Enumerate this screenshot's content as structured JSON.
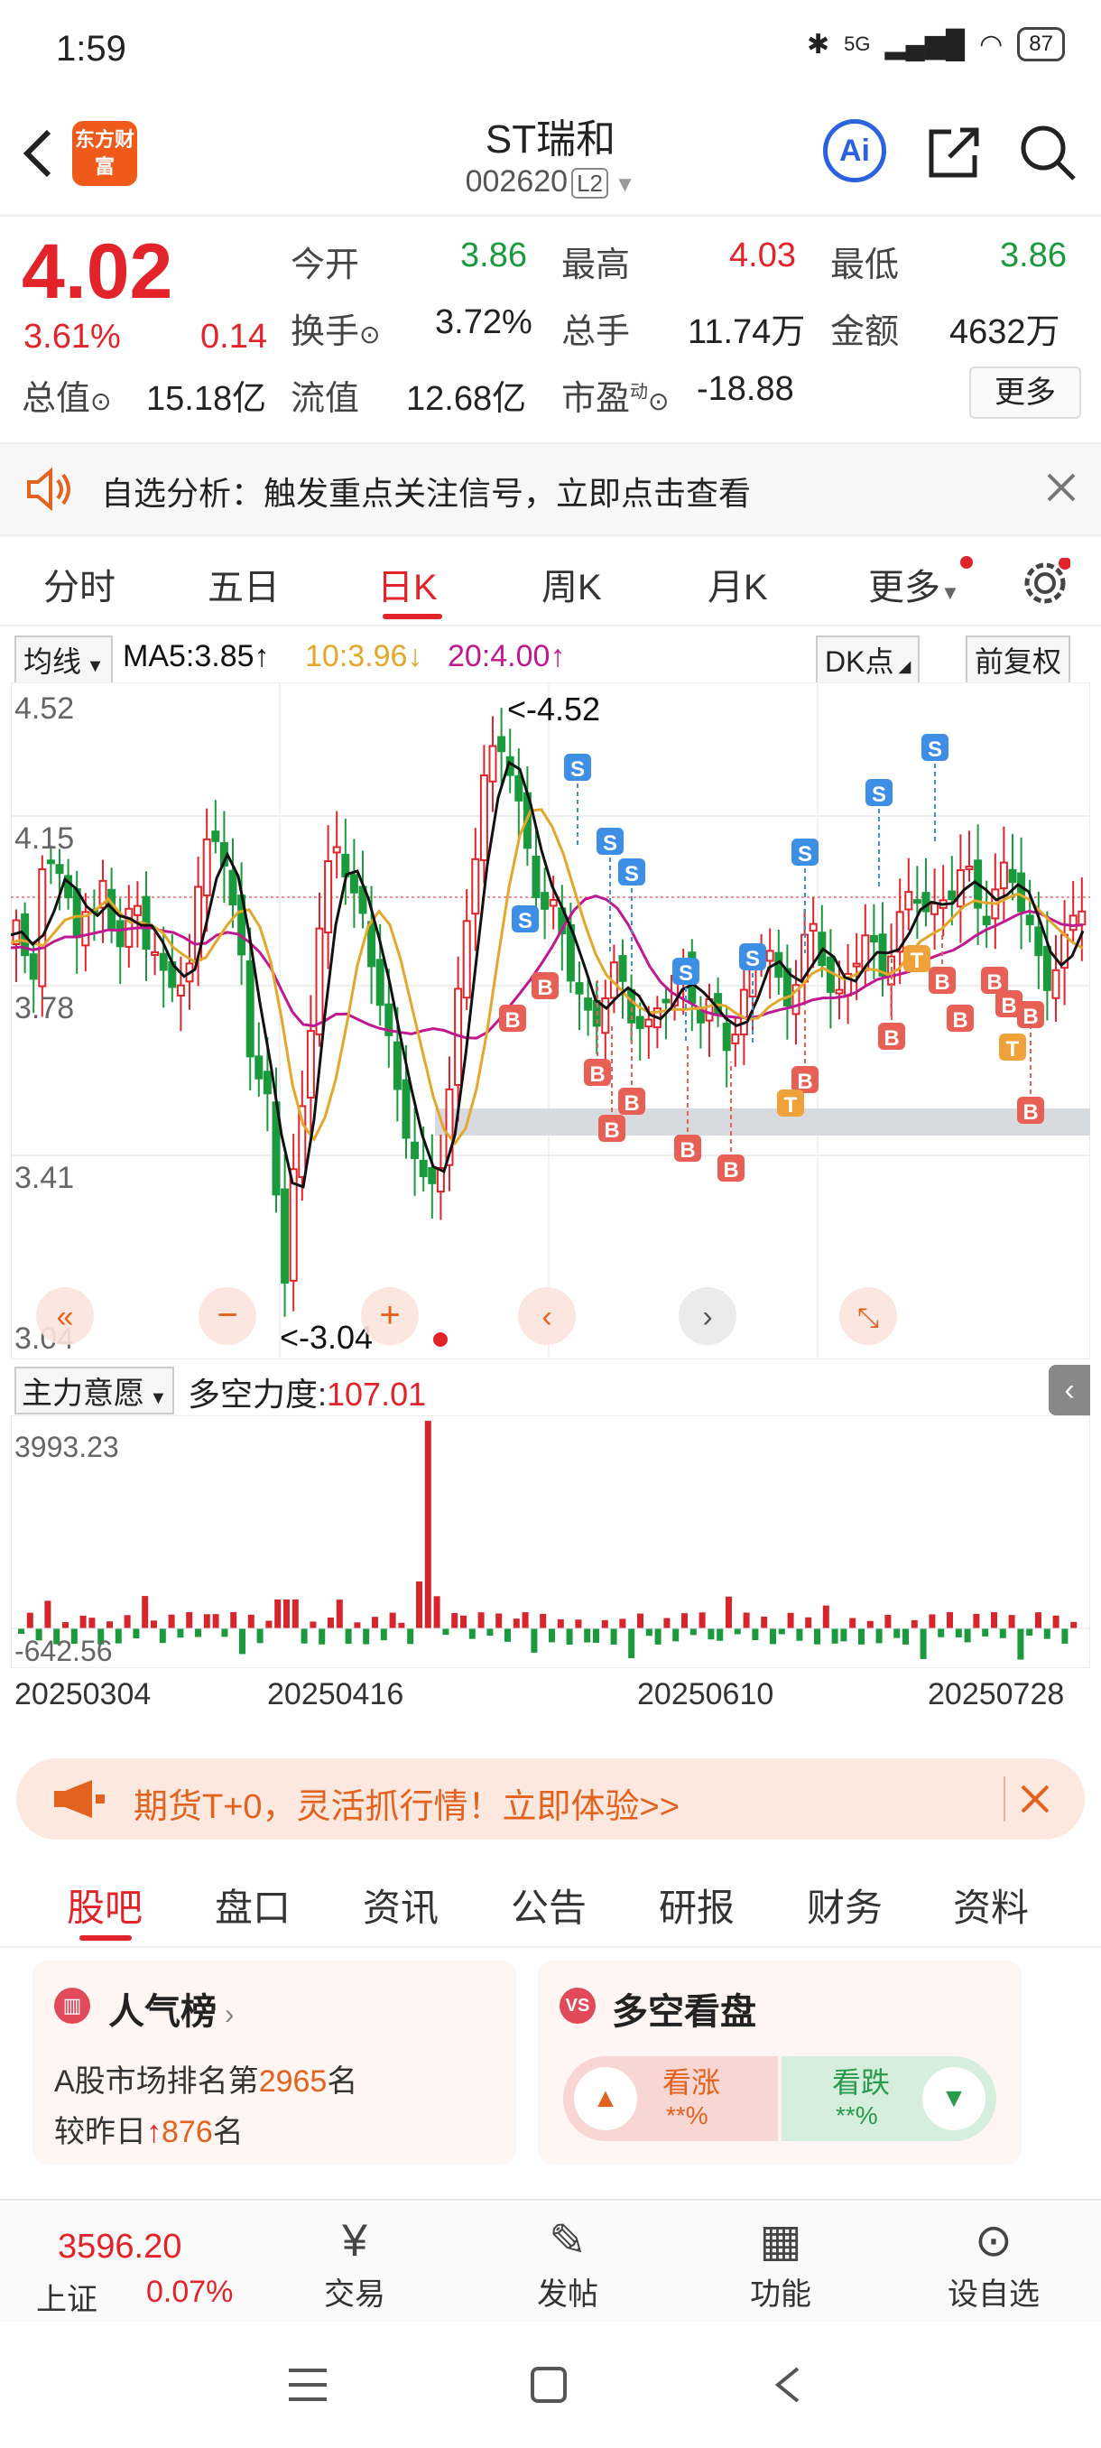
{
  "status_bar": {
    "time": "1:59",
    "network": "5G",
    "battery": "87"
  },
  "header": {
    "logo_text": "东方财富",
    "stock_name": "ST瑞和",
    "stock_code": "002620",
    "level": "L2",
    "ai_label": "Ai"
  },
  "quote": {
    "price": "4.02",
    "change_pct": "3.61%",
    "change": "0.14",
    "fields": [
      {
        "label": "今开",
        "value": "3.86",
        "color": "green"
      },
      {
        "label": "最高",
        "value": "4.03",
        "color": "red"
      },
      {
        "label": "最低",
        "value": "3.86",
        "color": "green"
      },
      {
        "label": "换手",
        "value": "3.72%",
        "color": "black"
      },
      {
        "label": "总手",
        "value": "11.74万",
        "color": "black"
      },
      {
        "label": "金额",
        "value": "4632万",
        "color": "black"
      },
      {
        "label": "总值",
        "value": "15.18亿",
        "color": "black"
      },
      {
        "label": "流值",
        "value": "12.68亿",
        "color": "black"
      },
      {
        "label": "市盈",
        "value": "-18.88",
        "color": "black"
      }
    ],
    "more_label": "更多",
    "pe_sup": "动"
  },
  "notification": {
    "text": "自选分析：触发重点关注信号，立即点击查看"
  },
  "chart_tabs": [
    "分时",
    "五日",
    "日K",
    "周K",
    "月K",
    "更多"
  ],
  "chart_tab_active": 2,
  "ma_row": {
    "selector": "均线",
    "ma5": "MA5:3.85",
    "ma10": "10:3.96",
    "ma20": "20:4.00",
    "dk": "DK点",
    "adjust": "前复权"
  },
  "chart_data": {
    "type": "candlestick",
    "title": "",
    "price_ticks": [
      "4.52",
      "4.15",
      "3.78",
      "3.41",
      "3.04"
    ],
    "ylim": [
      3.04,
      4.52
    ],
    "high_label": "<-4.52",
    "low_label": "<-3.04",
    "dates": [
      "20250304",
      "20250416",
      "20250610",
      "20250728"
    ],
    "volume_max_label": "3993.23",
    "volume_min_label": "-642.56",
    "signals": [
      "S",
      "B",
      "T"
    ]
  },
  "indicator": {
    "selector": "主力意愿",
    "label": "多空力度:",
    "value": "107.01"
  },
  "banner": {
    "text": "期货T+0，灵活抓行情！立即体验>>"
  },
  "info_tabs": [
    "股吧",
    "盘口",
    "资讯",
    "公告",
    "研报",
    "财务",
    "资料"
  ],
  "info_tab_active": 0,
  "card_popularity": {
    "title": "人气榜",
    "line1_prefix": "A股市场排名第",
    "rank": "2965",
    "line1_suffix": "名",
    "line2_prefix": "较昨日",
    "delta": "876",
    "line2_suffix": "名"
  },
  "card_sentiment": {
    "title": "多空看盘",
    "up_label": "看涨",
    "up_value": "**%",
    "down_label": "看跌",
    "down_value": "**%"
  },
  "bottom_nav": {
    "index_value": "3596.20",
    "index_name": "上证",
    "index_pct": "0.07%",
    "items": [
      "交易",
      "发帖",
      "功能",
      "设自选"
    ]
  }
}
